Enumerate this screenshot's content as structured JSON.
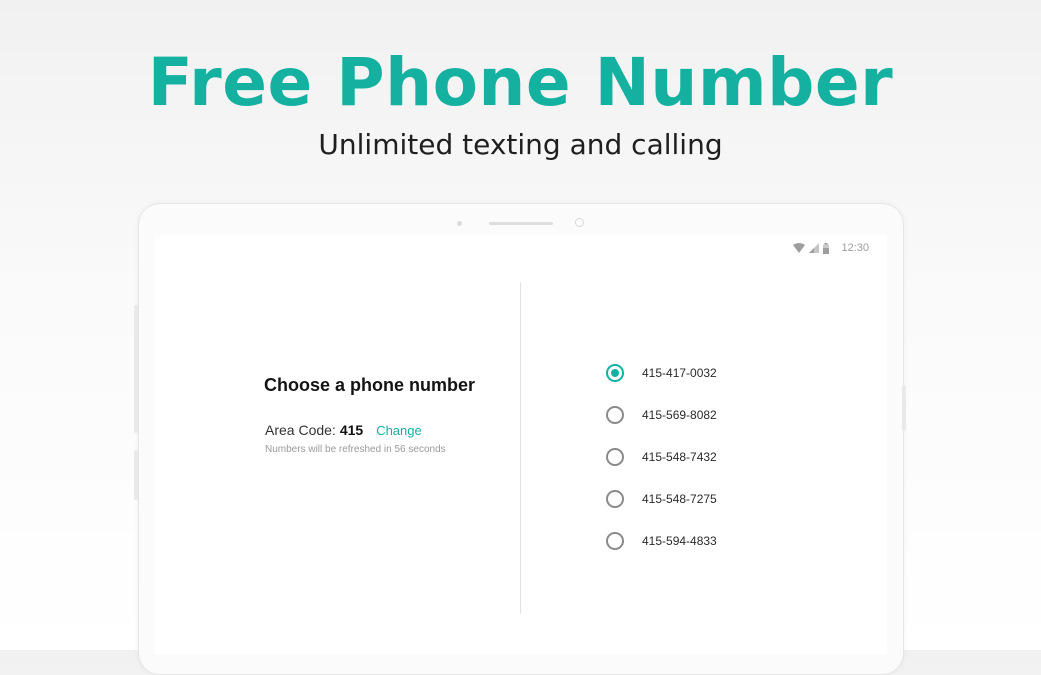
{
  "hero": {
    "title": "Free Phone Number",
    "subtitle": "Unlimited texting and calling"
  },
  "status_bar": {
    "time": "12:30",
    "icons": [
      "wifi-icon",
      "signal-icon",
      "battery-icon"
    ]
  },
  "picker": {
    "heading": "Choose a phone number",
    "area_code_label": "Area Code:",
    "area_code_value": "415",
    "change_label": "Change",
    "refresh_note": "Numbers will be refreshed in 56 seconds",
    "options": [
      {
        "number": "415-417-0032",
        "selected": true
      },
      {
        "number": "415-569-8082",
        "selected": false
      },
      {
        "number": "415-548-7432",
        "selected": false
      },
      {
        "number": "415-548-7275",
        "selected": false
      },
      {
        "number": "415-594-4833",
        "selected": false
      }
    ]
  },
  "colors": {
    "accent": "#14b1a1",
    "text": "#1f1f1f",
    "muted": "#9a9a9a"
  }
}
